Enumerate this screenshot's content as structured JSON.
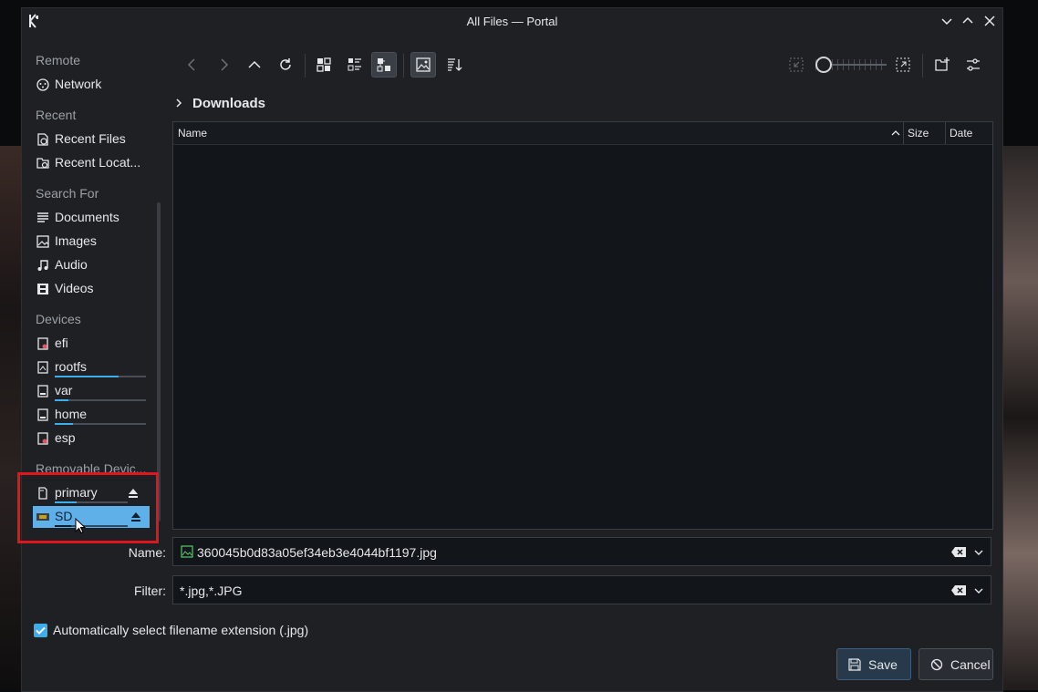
{
  "window": {
    "title": "All Files — Portal"
  },
  "places": {
    "sections": [
      {
        "header": "Remote",
        "items": [
          {
            "label": "Network",
            "icon": "network-icon"
          }
        ]
      },
      {
        "header": "Recent",
        "items": [
          {
            "label": "Recent Files",
            "icon": "recent-files-icon"
          },
          {
            "label": "Recent Locat...",
            "icon": "recent-locations-icon"
          }
        ]
      },
      {
        "header": "Search For",
        "items": [
          {
            "label": "Documents",
            "icon": "documents-icon"
          },
          {
            "label": "Images",
            "icon": "images-icon"
          },
          {
            "label": "Audio",
            "icon": "audio-icon"
          },
          {
            "label": "Videos",
            "icon": "videos-icon"
          }
        ]
      },
      {
        "header": "Devices",
        "items": [
          {
            "label": "efi"
          },
          {
            "label": "rootfs",
            "usage": 0.7
          },
          {
            "label": "var",
            "usage": 0.15
          },
          {
            "label": "home",
            "usage": 0.2
          },
          {
            "label": "esp"
          }
        ]
      },
      {
        "header": "Removable Devic...",
        "items": [
          {
            "label": "primary",
            "usage": 0.3
          },
          {
            "label": "SD",
            "usage": 0.22,
            "selected": true
          }
        ]
      }
    ]
  },
  "location": {
    "breadcrumb": "Downloads"
  },
  "file_view": {
    "columns": [
      "Name",
      "Size",
      "Date"
    ],
    "rows": []
  },
  "form": {
    "name_label": "Name:",
    "name_value": "360045b0d83a05ef34eb3e4044bf1197.jpg",
    "filter_label": "Filter:",
    "filter_value": "*.jpg,*.JPG",
    "auto_ext_label": "Automatically select filename extension (.jpg)",
    "auto_ext_checked": true
  },
  "buttons": {
    "save": "Save",
    "cancel": "Cancel"
  },
  "colors": {
    "accent": "#3daee9",
    "selected": "#5fb0e8",
    "highlight_box": "#e0151d"
  }
}
